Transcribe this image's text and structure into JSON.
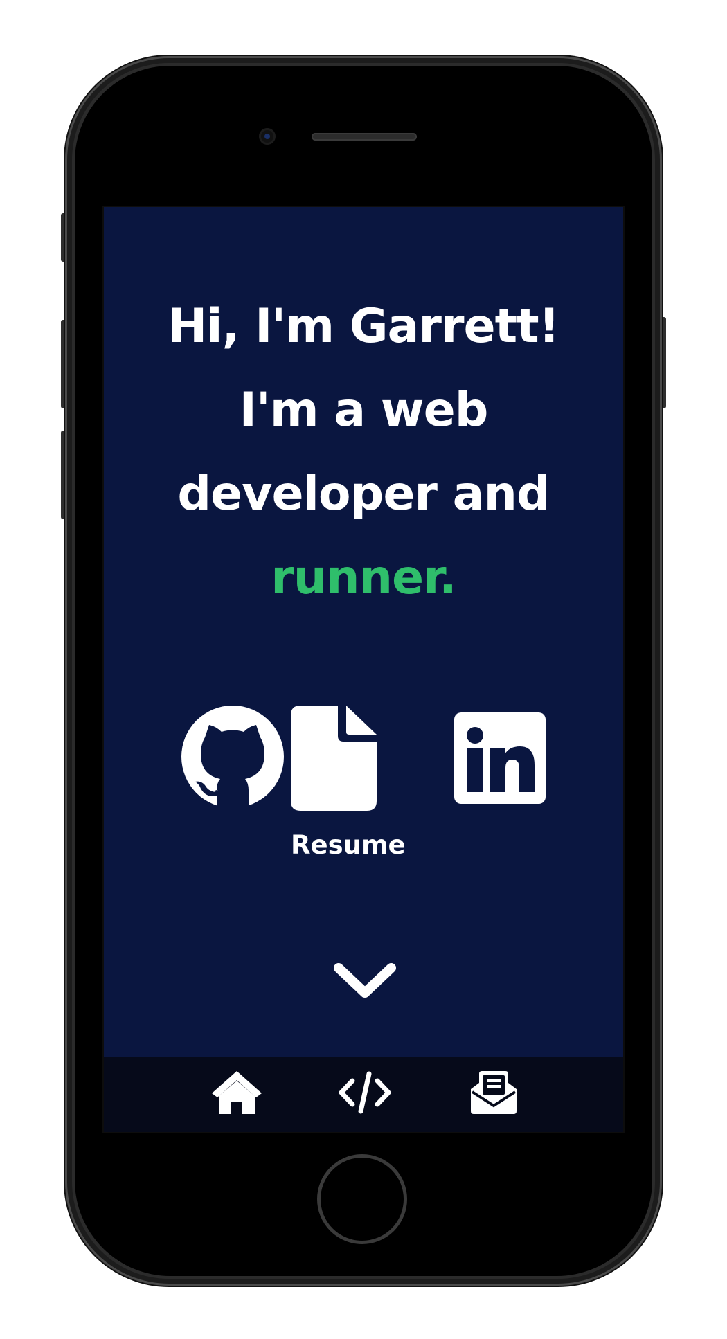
{
  "hero": {
    "line1": "Hi, I'm Garrett!",
    "line2": "I'm a web",
    "line3": "developer and",
    "line4_accent": "runner."
  },
  "links": {
    "github_icon": "github-icon",
    "resume_icon": "file-icon",
    "resume_label": "Resume",
    "linkedin_icon": "linkedin-icon"
  },
  "scroll": {
    "icon": "chevron-down-icon"
  },
  "nav": {
    "items": [
      {
        "icon": "home-icon"
      },
      {
        "icon": "code-icon"
      },
      {
        "icon": "envelope-open-icon"
      }
    ]
  },
  "colors": {
    "background": "#0a1640",
    "nav_background": "#060a1a",
    "text": "#ffffff",
    "accent": "#2fbe6b"
  }
}
